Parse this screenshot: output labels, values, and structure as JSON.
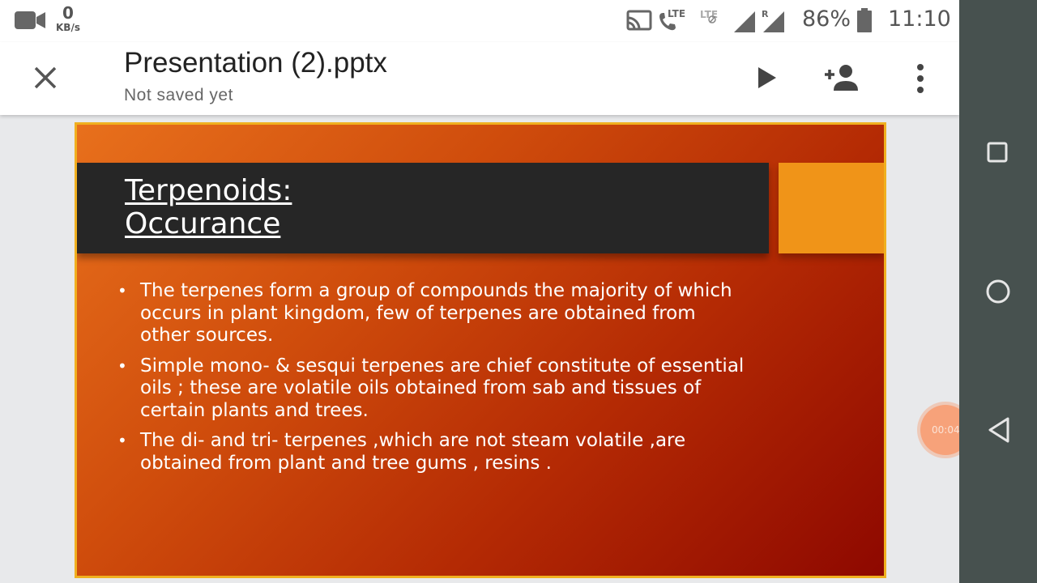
{
  "status_bar": {
    "net_speed_value": "0",
    "net_speed_unit": "KB/s",
    "network_labels": [
      "LTE",
      "LTE",
      "R"
    ],
    "battery_percent": "86%",
    "time": "11:10"
  },
  "app_bar": {
    "title": "Presentation (2).pptx",
    "subtitle": "Not saved yet",
    "icons": [
      "close-icon",
      "play-icon",
      "add-person-icon",
      "more-vert-icon"
    ]
  },
  "slide": {
    "title_line1": "Terpenoids:",
    "title_line2": "Occurance",
    "bullets": [
      "The terpenes form a group of compounds the majority of which occurs in plant kingdom, few of terpenes are obtained from other sources.",
      "Simple mono- & sesqui terpenes are chief constitute of essential oils ; these are volatile oils obtained from sab and tissues of certain plants and trees.",
      "The  di- and tri- terpenes ,which are not steam volatile ,are obtained from plant and tree gums , resins ."
    ],
    "colors": {
      "border": "#f0b020",
      "title_bar": "#262626",
      "accent": "#f09418",
      "gradient_start": "#e8701c",
      "gradient_end": "#8e0800"
    }
  },
  "recording": {
    "timer": "00:04"
  },
  "nav_bar": {
    "icons": [
      "recents-square-icon",
      "home-circle-icon",
      "back-triangle-icon"
    ]
  }
}
